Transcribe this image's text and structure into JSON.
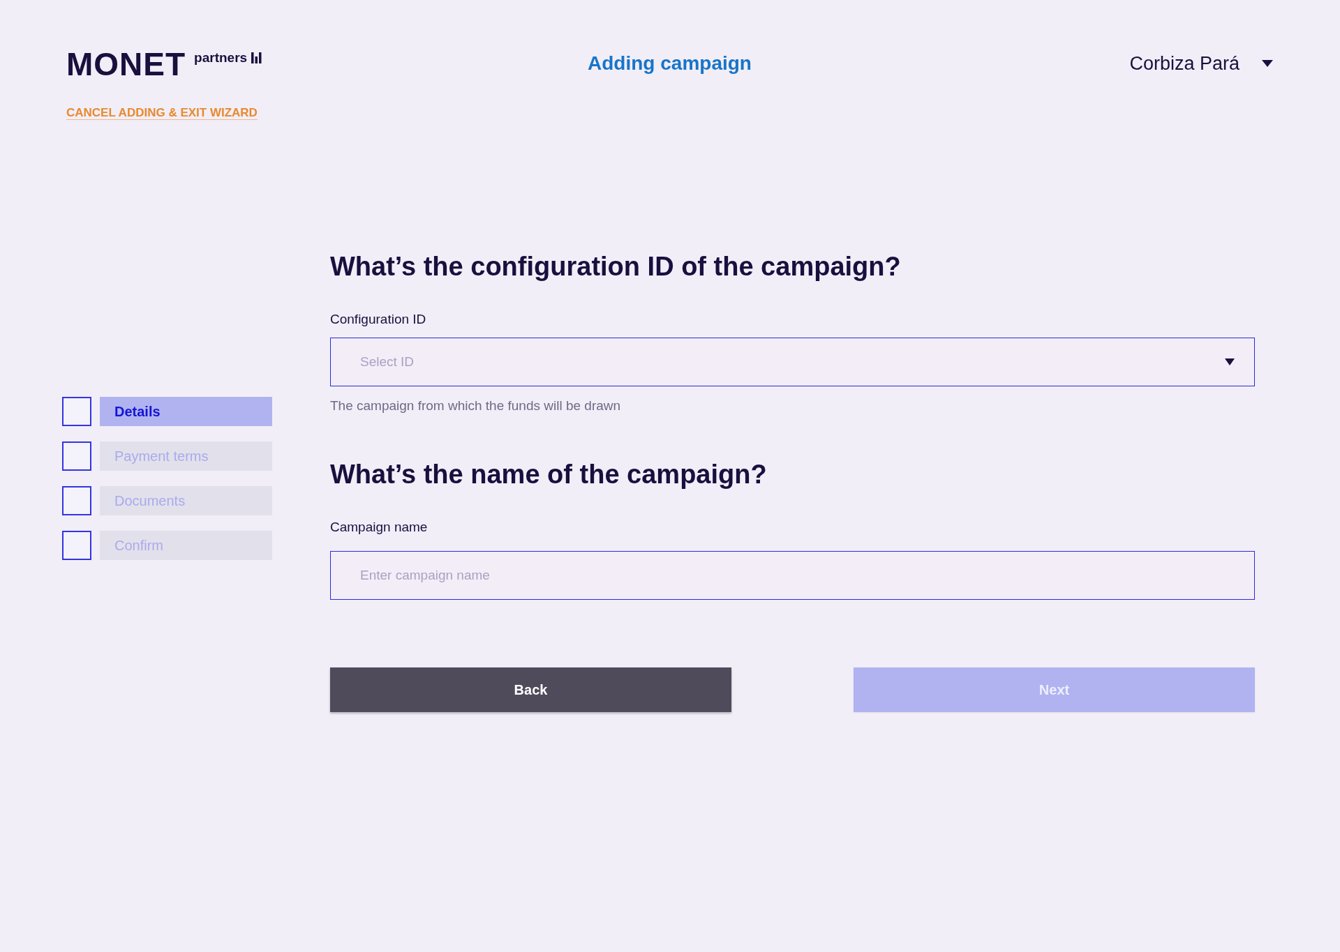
{
  "header": {
    "logo": {
      "wordmark": "MONET",
      "tagline": "partners"
    },
    "cancel_link": "CANCEL ADDING & EXIT WIZARD",
    "title": "Adding campaign",
    "user": {
      "name": "Corbiza Pará"
    }
  },
  "steps": [
    {
      "label": "Details",
      "selected": true,
      "checked": false
    },
    {
      "label": "Payment terms",
      "selected": false,
      "checked": false
    },
    {
      "label": "Documents",
      "selected": false,
      "checked": false
    },
    {
      "label": "Confirm",
      "selected": false,
      "checked": false
    }
  ],
  "sections": [
    {
      "heading": "What’s the configuration ID of the campaign?",
      "field": {
        "kind": "select",
        "label": "Configuration ID",
        "placeholder": "Select ID",
        "hint": "The campaign from which the funds will be drawn"
      }
    },
    {
      "heading": "What’s the name of the campaign?",
      "field": {
        "kind": "text",
        "label": "Campaign name",
        "placeholder": "Enter campaign name"
      }
    }
  ],
  "buttons": [
    {
      "label": "Back",
      "disabled": false
    },
    {
      "label": "Next",
      "disabled": true
    }
  ]
}
